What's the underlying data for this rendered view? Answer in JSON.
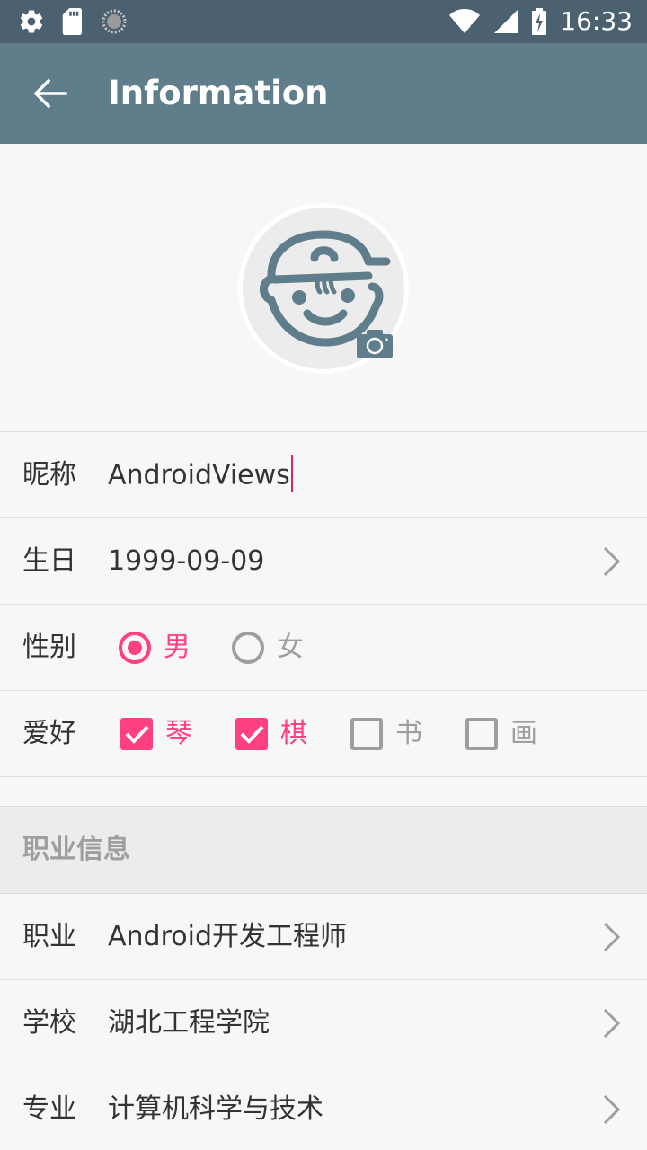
{
  "status_bar": {
    "time": "16:33",
    "left_icons": [
      "settings-icon",
      "sd-card-icon",
      "sync-icon"
    ],
    "right_icons": [
      "wifi-icon",
      "signal-icon",
      "battery-charging-icon"
    ]
  },
  "app_bar": {
    "title": "Information",
    "back_icon": "arrow-back-icon"
  },
  "avatar": {
    "icon": "cartoon-face-icon",
    "camera_icon": "camera-icon"
  },
  "form": {
    "nickname": {
      "label": "昵称",
      "value": "AndroidViews"
    },
    "birthday": {
      "label": "生日",
      "value": "1999-09-09"
    },
    "gender": {
      "label": "性别",
      "options": [
        {
          "label": "男",
          "selected": true
        },
        {
          "label": "女",
          "selected": false
        }
      ]
    },
    "hobby": {
      "label": "爱好",
      "options": [
        {
          "label": "琴",
          "checked": true
        },
        {
          "label": "棋",
          "checked": true
        },
        {
          "label": "书",
          "checked": false
        },
        {
          "label": "画",
          "checked": false
        }
      ]
    }
  },
  "career_section": {
    "title": "职业信息",
    "job": {
      "label": "职业",
      "value": "Android开发工程师"
    },
    "school": {
      "label": "学校",
      "value": "湖北工程学院"
    },
    "major": {
      "label": "专业",
      "value": "计算机科学与技术"
    }
  },
  "colors": {
    "status_bar": "#4b6170",
    "app_bar": "#5f7d8b",
    "accent": "#ff4081",
    "background": "#f7f7f7"
  }
}
